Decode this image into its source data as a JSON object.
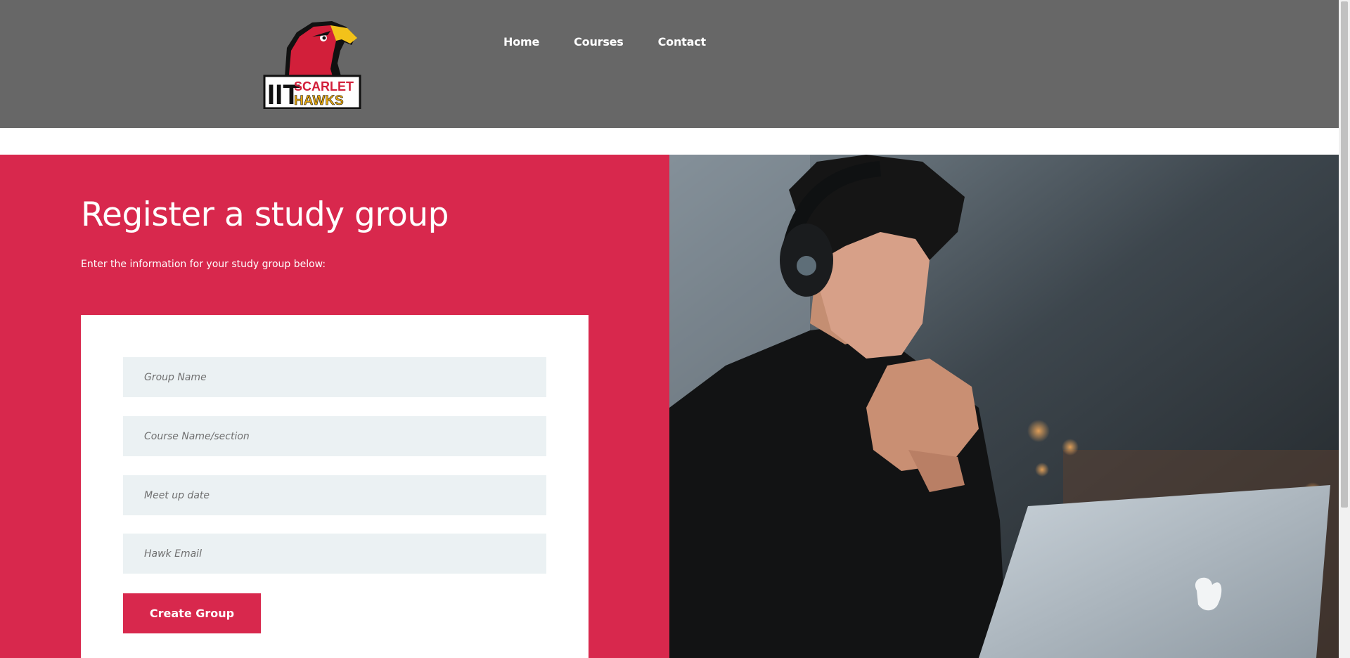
{
  "header": {
    "logo": {
      "line1": "IIT",
      "line2": "SCARLET",
      "line3": "HAWKS"
    },
    "nav": [
      {
        "label": "Home"
      },
      {
        "label": "Courses"
      },
      {
        "label": "Contact"
      }
    ]
  },
  "hero": {
    "title": "Register a study group",
    "subtitle": "Enter the information for your study group below:",
    "form": {
      "fields": [
        {
          "placeholder": "Group Name",
          "value": ""
        },
        {
          "placeholder": "Course Name/section",
          "value": ""
        },
        {
          "placeholder": "Meet up date",
          "value": ""
        },
        {
          "placeholder": "Hawk Email",
          "value": ""
        }
      ],
      "submit_label": "Create Group"
    },
    "photo_icon": "student-with-headphones-at-laptop-photo"
  },
  "colors": {
    "header_bg": "#676767",
    "accent": "#d8284d",
    "field_bg": "#ebf1f3",
    "card_bg": "#ffffff"
  }
}
